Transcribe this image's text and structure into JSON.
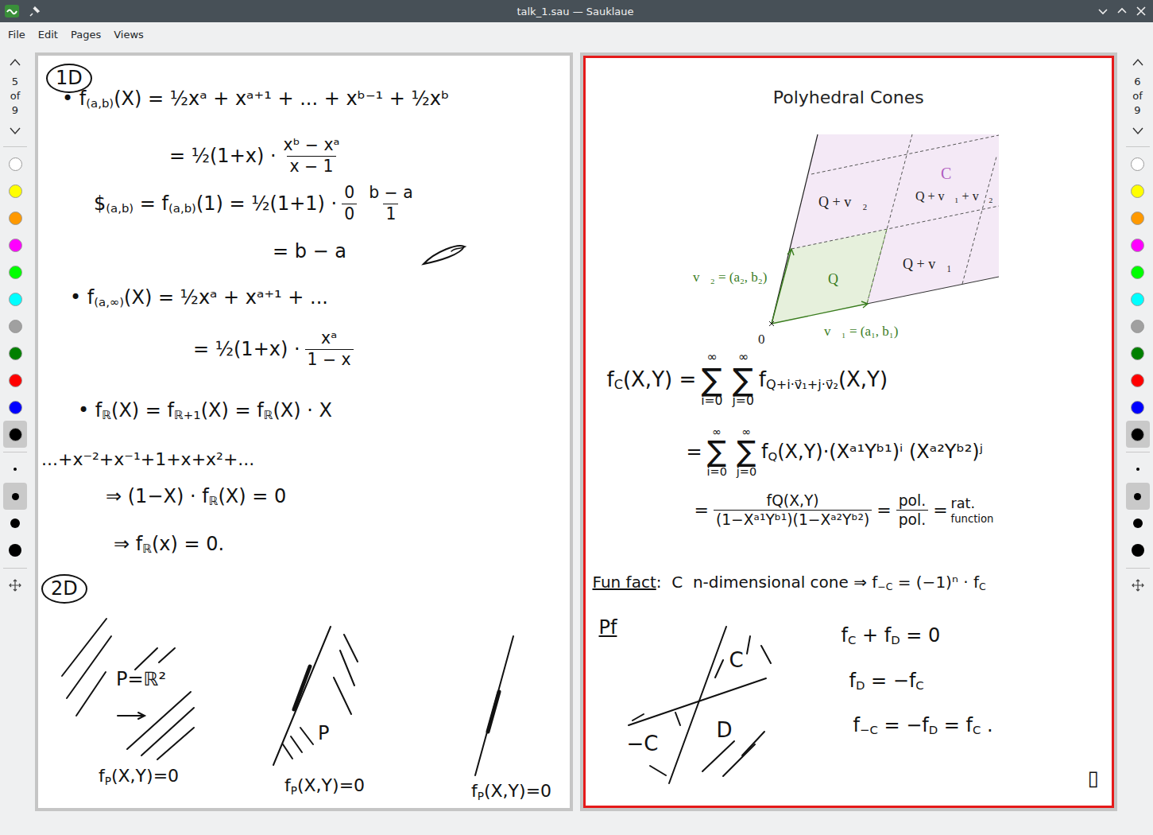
{
  "window": {
    "title": "talk_1.sau — Sauklaue"
  },
  "menu": [
    "File",
    "Edit",
    "Pages",
    "Views"
  ],
  "sidebars": [
    {
      "side": "left",
      "page": "5",
      "of": "of",
      "total": "9",
      "colors": [
        {
          "color": "#ffffff",
          "selected": false
        },
        {
          "color": "#ffff00",
          "selected": false
        },
        {
          "color": "#ff9900",
          "selected": false
        },
        {
          "color": "#ff00ff",
          "selected": false
        },
        {
          "color": "#00ff00",
          "selected": false
        },
        {
          "color": "#00ffff",
          "selected": false
        },
        {
          "color": "#a0a0a0",
          "selected": false
        },
        {
          "color": "#008000",
          "selected": false
        },
        {
          "color": "#ff0000",
          "selected": false
        },
        {
          "color": "#0000ff",
          "selected": false
        },
        {
          "color": "#000000",
          "selected": true
        }
      ],
      "sizes": [
        {
          "selected": false
        },
        {
          "selected": true
        },
        {
          "selected": false
        },
        {
          "selected": false
        }
      ]
    },
    {
      "side": "right",
      "page": "6",
      "of": "of",
      "total": "9",
      "colors": [
        {
          "color": "#ffffff",
          "selected": false
        },
        {
          "color": "#ffff00",
          "selected": false
        },
        {
          "color": "#ff9900",
          "selected": false
        },
        {
          "color": "#ff00ff",
          "selected": false
        },
        {
          "color": "#00ff00",
          "selected": false
        },
        {
          "color": "#00ffff",
          "selected": false
        },
        {
          "color": "#a0a0a0",
          "selected": false
        },
        {
          "color": "#008000",
          "selected": false
        },
        {
          "color": "#ff0000",
          "selected": false
        },
        {
          "color": "#0000ff",
          "selected": false
        },
        {
          "color": "#000000",
          "selected": true
        }
      ],
      "sizes": [
        {
          "selected": false
        },
        {
          "selected": true
        },
        {
          "selected": false
        },
        {
          "selected": false
        }
      ]
    }
  ],
  "pages": [
    {
      "selected": false,
      "title": "",
      "diagram_labels": [],
      "notes": [
        {
          "circled": true,
          "parts": [
            {
              "kind": "text",
              "text": "1D",
              "underline": false
            }
          ]
        },
        {
          "circled": false,
          "parts": [
            {
              "kind": "text",
              "text": "• f",
              "underline": false
            },
            {
              "kind": "sub",
              "text": "(a,b)"
            },
            {
              "kind": "text",
              "text": "(X) = ½xᵃ + xᵃ⁺¹ + ... + xᵇ⁻¹ + ½xᵇ",
              "underline": false
            }
          ]
        },
        {
          "circled": false,
          "parts": [
            {
              "kind": "text",
              "text": "= ½(1+x) ·",
              "underline": false
            },
            {
              "kind": "frac",
              "num": "xᵇ − xᵃ",
              "den": "x − 1"
            }
          ]
        },
        {
          "circled": false,
          "parts": [
            {
              "kind": "text",
              "text": "$",
              "underline": false
            },
            {
              "kind": "sub",
              "text": "(a,b)"
            },
            {
              "kind": "text",
              "text": " = f",
              "underline": false
            },
            {
              "kind": "sub",
              "text": "(a,b)"
            },
            {
              "kind": "text",
              "text": "(1) = ½(1+1) ·",
              "underline": false
            },
            {
              "kind": "frac",
              "num": "0",
              "den": "0"
            },
            {
              "kind": "frac",
              "num": "b − a",
              "den": "1"
            }
          ]
        },
        {
          "circled": false,
          "parts": [
            {
              "kind": "text",
              "text": "= b − a",
              "underline": false
            }
          ]
        },
        {
          "circled": false,
          "parts": [
            {
              "kind": "text",
              "text": "• f",
              "underline": false
            },
            {
              "kind": "sub",
              "text": "(a,∞)"
            },
            {
              "kind": "text",
              "text": "(X) = ½xᵃ + xᵃ⁺¹ + ...",
              "underline": false
            }
          ]
        },
        {
          "circled": false,
          "parts": [
            {
              "kind": "text",
              "text": "= ½(1+x) ·",
              "underline": false
            },
            {
              "kind": "frac",
              "num": "xᵃ",
              "den": "1 − x"
            }
          ]
        },
        {
          "circled": false,
          "parts": [
            {
              "kind": "text",
              "text": "• f",
              "underline": false
            },
            {
              "kind": "sub",
              "text": "ℝ"
            },
            {
              "kind": "text",
              "text": "(X) = f",
              "underline": false
            },
            {
              "kind": "sub",
              "text": "ℝ+1"
            },
            {
              "kind": "text",
              "text": "(X) = f",
              "underline": false
            },
            {
              "kind": "sub",
              "text": "ℝ"
            },
            {
              "kind": "text",
              "text": "(X) · X",
              "underline": false
            }
          ]
        },
        {
          "circled": false,
          "parts": [
            {
              "kind": "text",
              "text": "...+x⁻²+x⁻¹+1+x+x²+...",
              "underline": false
            }
          ]
        },
        {
          "circled": false,
          "parts": [
            {
              "kind": "text",
              "text": "⇒ (1−X) · f",
              "underline": false
            },
            {
              "kind": "sub",
              "text": "ℝ"
            },
            {
              "kind": "text",
              "text": "(X) = 0",
              "underline": false
            }
          ]
        },
        {
          "circled": false,
          "parts": [
            {
              "kind": "text",
              "text": "⇒ f",
              "underline": false
            },
            {
              "kind": "sub",
              "text": "ℝ"
            },
            {
              "kind": "text",
              "text": "(x) = 0.",
              "underline": false
            }
          ]
        },
        {
          "circled": true,
          "parts": [
            {
              "kind": "text",
              "text": "2D",
              "underline": false
            }
          ]
        },
        {
          "circled": false,
          "parts": [
            {
              "kind": "text",
              "text": "P=ℝ²",
              "underline": false
            }
          ]
        },
        {
          "circled": false,
          "parts": [
            {
              "kind": "text",
              "text": "P",
              "underline": false
            }
          ]
        },
        {
          "circled": false,
          "parts": [
            {
              "kind": "text",
              "text": "f",
              "underline": false
            },
            {
              "kind": "sub",
              "text": "P"
            },
            {
              "kind": "text",
              "text": "(X,Y)=0",
              "underline": false
            }
          ]
        },
        {
          "circled": false,
          "parts": [
            {
              "kind": "text",
              "text": "f",
              "underline": false
            },
            {
              "kind": "sub",
              "text": "P"
            },
            {
              "kind": "text",
              "text": "(X,Y)=0",
              "underline": false
            }
          ]
        },
        {
          "circled": false,
          "parts": [
            {
              "kind": "text",
              "text": "f",
              "underline": false
            },
            {
              "kind": "sub",
              "text": "P"
            },
            {
              "kind": "text",
              "text": "(X,Y)=0",
              "underline": false
            }
          ]
        }
      ]
    },
    {
      "selected": true,
      "title": "Polyhedral Cones",
      "diagram_labels": [
        {
          "text": "C",
          "color": "#b05cc0"
        },
        {
          "text": "Q + v⃗₂",
          "color": "#222222"
        },
        {
          "text": "Q + v⃗₁ + v⃗₂",
          "color": "#222222"
        },
        {
          "text": "Q",
          "color": "#3a7d1e"
        },
        {
          "text": "Q + v⃗₁",
          "color": "#222222"
        },
        {
          "text": "v⃗₂ = (a₂, b₂)",
          "color": "#3a7d1e"
        },
        {
          "text": "v⃗₁ = (a₁, b₁)",
          "color": "#3a7d1e"
        },
        {
          "text": "0",
          "color": "#222222"
        }
      ],
      "notes": [
        {
          "circled": false,
          "parts": [
            {
              "kind": "text",
              "text": "f",
              "underline": false
            },
            {
              "kind": "sub",
              "text": "C"
            },
            {
              "kind": "text",
              "text": "(X,Y) =",
              "underline": false
            },
            {
              "kind": "sum",
              "symbol": "∑",
              "top": "∞",
              "bottom": "i=0"
            },
            {
              "kind": "sum",
              "symbol": "∑",
              "top": "∞",
              "bottom": "j=0"
            },
            {
              "kind": "text",
              "text": "f",
              "underline": false
            },
            {
              "kind": "sub",
              "text": "Q+i·v⃗₁+j·v⃗₂"
            },
            {
              "kind": "text",
              "text": "(X,Y)",
              "underline": false
            }
          ]
        },
        {
          "circled": false,
          "parts": [
            {
              "kind": "text",
              "text": "=",
              "underline": false
            },
            {
              "kind": "sum",
              "symbol": "∑",
              "top": "∞",
              "bottom": "i=0"
            },
            {
              "kind": "sum",
              "symbol": "∑",
              "top": "∞",
              "bottom": "j=0"
            },
            {
              "kind": "text",
              "text": "f",
              "underline": false
            },
            {
              "kind": "sub",
              "text": "Q"
            },
            {
              "kind": "text",
              "text": "(X,Y)·(Xᵃ¹Yᵇ¹)ⁱ (Xᵃ²Yᵇ²)ʲ",
              "underline": false
            }
          ]
        },
        {
          "circled": false,
          "parts": [
            {
              "kind": "text",
              "text": "=",
              "underline": false
            },
            {
              "kind": "frac",
              "num": "fQ(X,Y)",
              "den": "(1−Xᵃ¹Yᵇ¹)(1−Xᵃ²Yᵇ²)"
            },
            {
              "kind": "text",
              "text": "=",
              "underline": false
            },
            {
              "kind": "frac",
              "num": "pol.",
              "den": "pol."
            },
            {
              "kind": "text",
              "text": "=",
              "underline": false
            },
            {
              "kind": "stack",
              "top": "rat.",
              "bottom": "function"
            }
          ]
        },
        {
          "circled": false,
          "parts": [
            {
              "kind": "text",
              "text": "Fun fact",
              "underline": true
            },
            {
              "kind": "text",
              "text": ":  C  n-dimensional cone ⇒ f",
              "underline": false
            },
            {
              "kind": "sub",
              "text": "−C"
            },
            {
              "kind": "text",
              "text": " = (−1)ⁿ · f",
              "underline": false
            },
            {
              "kind": "sub",
              "text": "C"
            }
          ]
        },
        {
          "circled": false,
          "parts": [
            {
              "kind": "text",
              "text": "Pf",
              "underline": true
            }
          ]
        },
        {
          "circled": false,
          "parts": [
            {
              "kind": "text",
              "text": "C",
              "underline": false
            }
          ]
        },
        {
          "circled": false,
          "parts": [
            {
              "kind": "text",
              "text": "−C",
              "underline": false
            }
          ]
        },
        {
          "circled": false,
          "parts": [
            {
              "kind": "text",
              "text": "D",
              "underline": false
            }
          ]
        },
        {
          "circled": false,
          "parts": [
            {
              "kind": "text",
              "text": "f",
              "underline": false
            },
            {
              "kind": "sub",
              "text": "C"
            },
            {
              "kind": "text",
              "text": " + f",
              "underline": false
            },
            {
              "kind": "sub",
              "text": "D"
            },
            {
              "kind": "text",
              "text": " = 0",
              "underline": false
            }
          ]
        },
        {
          "circled": false,
          "parts": [
            {
              "kind": "text",
              "text": "f",
              "underline": false
            },
            {
              "kind": "sub",
              "text": "D"
            },
            {
              "kind": "text",
              "text": " = −f",
              "underline": false
            },
            {
              "kind": "sub",
              "text": "C"
            }
          ]
        },
        {
          "circled": false,
          "parts": [
            {
              "kind": "text",
              "text": "f",
              "underline": false
            },
            {
              "kind": "sub",
              "text": "−C"
            },
            {
              "kind": "text",
              "text": " = −f",
              "underline": false
            },
            {
              "kind": "sub",
              "text": "D"
            },
            {
              "kind": "text",
              "text": " = f",
              "underline": false
            },
            {
              "kind": "sub",
              "text": "C"
            },
            {
              "kind": "text",
              "text": " .",
              "underline": false
            }
          ]
        },
        {
          "circled": false,
          "parts": [
            {
              "kind": "text",
              "text": "▯",
              "underline": false
            }
          ]
        }
      ]
    }
  ]
}
